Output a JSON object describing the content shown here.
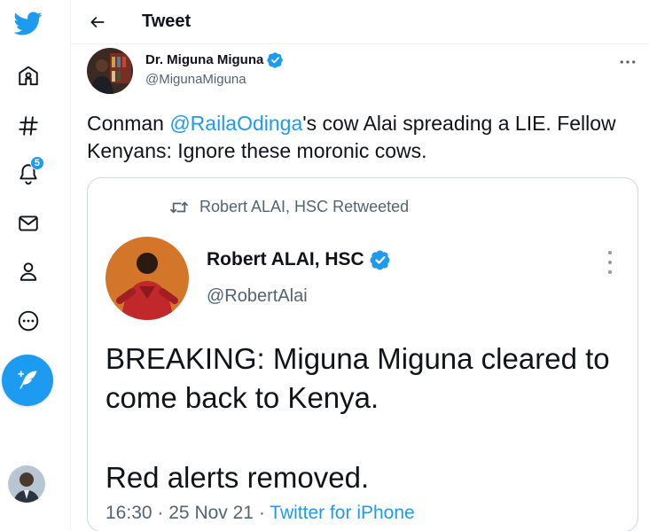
{
  "nav": {
    "logo_icon": "twitter-bird-icon",
    "items": [
      {
        "icon": "home-icon",
        "label": "Home"
      },
      {
        "icon": "hashtag-icon",
        "label": "Explore"
      },
      {
        "icon": "bell-icon",
        "label": "Notifications",
        "badge": "5"
      },
      {
        "icon": "mail-icon",
        "label": "Messages"
      },
      {
        "icon": "profile-icon",
        "label": "Profile"
      },
      {
        "icon": "more-circle-icon",
        "label": "More"
      }
    ],
    "compose_icon": "feather-plus-icon",
    "accent": "#1d9bf0"
  },
  "header": {
    "title": "Tweet",
    "back_icon": "arrow-left-icon"
  },
  "tweet": {
    "author_name": "Dr. Miguna Miguna",
    "author_handle": "@MigunaMiguna",
    "verified": true,
    "text_before": "Conman ",
    "mention": "@RailaOdinga",
    "text_after": "'s cow Alai spreading a LIE. Fellow Kenyans: Ignore these moronic cows."
  },
  "embedded": {
    "retweet_label": "Robert ALAI, HSC Retweeted",
    "author_name": "Robert ALAI, HSC",
    "author_handle": "@RobertAlai",
    "verified": true,
    "body_line1": "BREAKING: Miguna Miguna cleared to come back to Kenya.",
    "body_line2": "Red alerts removed.",
    "time": "16:30",
    "date": "25 Nov 21",
    "separator": "·",
    "source": "Twitter for iPhone"
  }
}
